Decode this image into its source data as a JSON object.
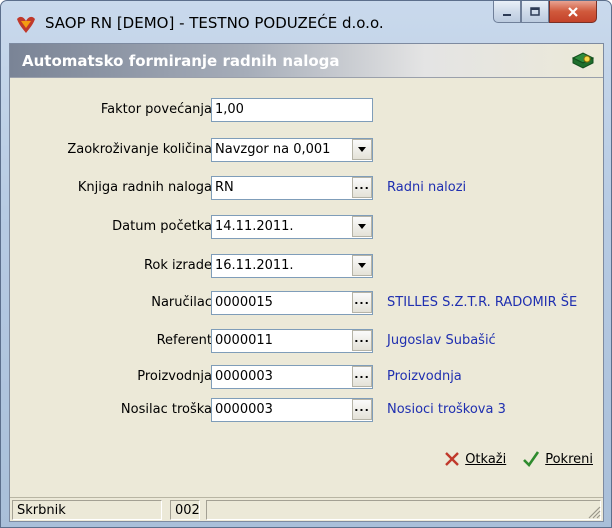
{
  "window": {
    "title": "SAOP RN [DEMO] - TESTNO PODUZEĆE d.o.o."
  },
  "form": {
    "header_title": "Automatsko formiranje radnih naloga",
    "fields": {
      "faktor_povecanja": {
        "label": "Faktor povećanja",
        "value": "1,00"
      },
      "zaokrozivanje": {
        "label": "Zaokroživanje količina",
        "value": "Navzgor na 0,001"
      },
      "knjiga": {
        "label": "Knjiga radnih naloga",
        "value": "RN",
        "description": "Radni nalozi"
      },
      "datum_pocetka": {
        "label": "Datum početka",
        "value": "14.11.2011."
      },
      "rok_izrade": {
        "label": "Rok izrade",
        "value": "16.11.2011."
      },
      "narucilac": {
        "label": "Naručilac",
        "value": "0000015",
        "description": "STILLES S.Z.T.R. RADOMIR ŠE"
      },
      "referent": {
        "label": "Referent",
        "value": "0000011",
        "description": "Jugoslav Subašić"
      },
      "proizvodnja": {
        "label": "Proizvodnja",
        "value": "0000003",
        "description": "Proizvodnja"
      },
      "nosilac_troska": {
        "label": "Nosilac troška",
        "value": "0000003",
        "description": "Nosioci troškova 3"
      }
    }
  },
  "actions": {
    "cancel_label": "Otkaži",
    "start_label": "Pokreni"
  },
  "statusbar": {
    "user": "Skrbnik",
    "code": "002"
  },
  "colors": {
    "description_link": "#1f2fb0",
    "header_bar": "#7a8496",
    "panel": "#ece9d8"
  }
}
